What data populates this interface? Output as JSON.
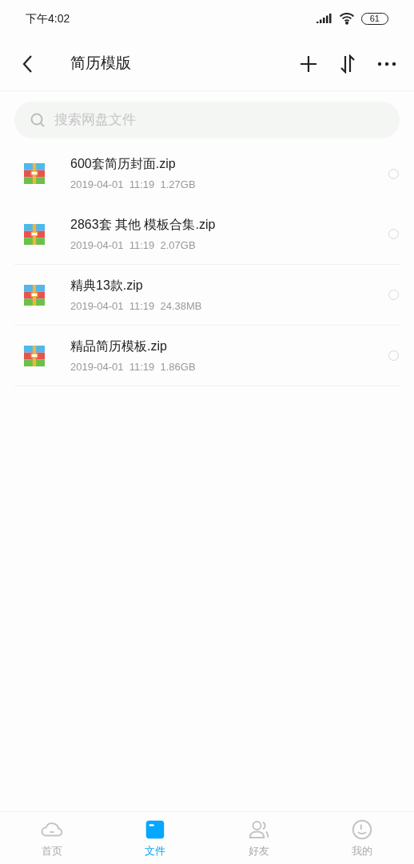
{
  "status_bar": {
    "time": "下午4:02",
    "battery": "61"
  },
  "header": {
    "title": "简历模版"
  },
  "search": {
    "placeholder": "搜索网盘文件"
  },
  "files": [
    {
      "name": "600套简历封面.zip",
      "meta": "2019-04-01  11:19  1.27GB",
      "selected": false
    },
    {
      "name": "2863套 其他 模板合集.zip",
      "meta": "2019-04-01  11:19  2.07GB",
      "selected": false
    },
    {
      "name": "精典13款.zip",
      "meta": "2019-04-01  11:19  24.38MB",
      "selected": false
    },
    {
      "name": "精品简历模板.zip",
      "meta": "2019-04-01  11:19  1.86GB",
      "selected": false
    }
  ],
  "tabs": [
    {
      "label": "首页",
      "kind": "home",
      "selected": false
    },
    {
      "label": "文件",
      "kind": "files",
      "selected": true
    },
    {
      "label": "好友",
      "kind": "friends",
      "selected": false
    },
    {
      "label": "我的",
      "kind": "me",
      "selected": false
    }
  ]
}
